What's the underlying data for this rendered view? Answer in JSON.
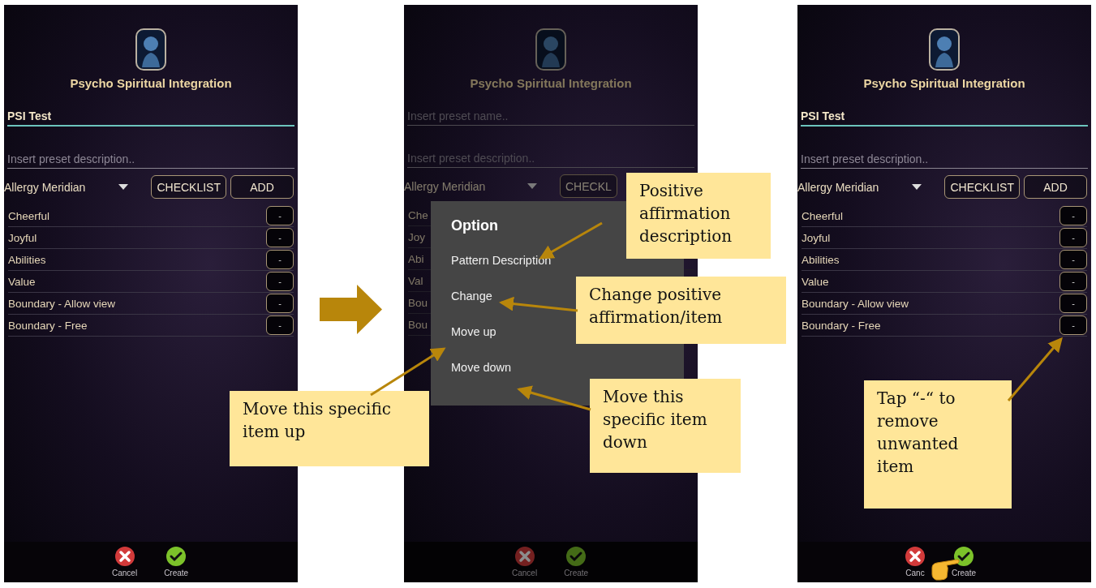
{
  "phones": [
    {
      "dimmed": false,
      "title": "Psycho Spiritual Integration",
      "name_field": {
        "value": "PSI Test",
        "focused": true
      },
      "description_field": {
        "placeholder": "Insert preset description.."
      },
      "dropdown": {
        "value": "Allergy Meridian"
      },
      "buttons": [
        "CHECKLIST",
        "ADD"
      ],
      "remove_buttons": true,
      "items": [
        {
          "label": "Cheerful",
          "remove": "-"
        },
        {
          "label": "Joyful",
          "remove": "-"
        },
        {
          "label": "Abilities",
          "remove": "-"
        },
        {
          "label": "Value",
          "remove": "-"
        },
        {
          "label": "Boundary - Allow view",
          "remove": "-"
        },
        {
          "label": "Boundary - Free",
          "remove": "-"
        }
      ],
      "footer": [
        {
          "kind": "cancel",
          "label": "Cancel"
        },
        {
          "kind": "create",
          "label": "Create"
        }
      ],
      "pointer_hand": false
    },
    {
      "dimmed": true,
      "title": "Psycho Spiritual Integration",
      "name_field": {
        "placeholder": "Insert preset name..",
        "focused": false
      },
      "description_field": {
        "placeholder": "Insert preset description.."
      },
      "dropdown": {
        "value": "Allergy Meridian"
      },
      "buttons": [
        "CHECKL"
      ],
      "remove_buttons": false,
      "items": [
        {
          "label": "Che"
        },
        {
          "label": "Joy"
        },
        {
          "label": "Abi"
        },
        {
          "label": "Val"
        },
        {
          "label": "Bou"
        },
        {
          "label": "Bou"
        }
      ],
      "footer": [
        {
          "kind": "cancel",
          "label": "Cancel"
        },
        {
          "kind": "create",
          "label": "Create"
        }
      ],
      "pointer_hand": false,
      "dialog": {
        "title": "Option",
        "options": [
          "Pattern Description",
          "Change",
          "Move up",
          "Move down"
        ]
      }
    },
    {
      "dimmed": false,
      "title": "Psycho Spiritual Integration",
      "name_field": {
        "value": "PSI Test",
        "focused": true
      },
      "description_field": {
        "placeholder": "Insert preset description.."
      },
      "dropdown": {
        "value": "Allergy Meridian"
      },
      "buttons": [
        "CHECKLIST",
        "ADD"
      ],
      "remove_buttons": true,
      "items": [
        {
          "label": "Cheerful",
          "remove": "-"
        },
        {
          "label": "Joyful",
          "remove": "-"
        },
        {
          "label": "Abilities",
          "remove": "-"
        },
        {
          "label": "Value",
          "remove": "-"
        },
        {
          "label": "Boundary - Allow view",
          "remove": "-"
        },
        {
          "label": "Boundary - Free",
          "remove": "-"
        }
      ],
      "footer": [
        {
          "kind": "cancel",
          "label": "Canc"
        },
        {
          "kind": "create",
          "label": "Create"
        }
      ],
      "pointer_hand": true
    }
  ],
  "callouts": [
    {
      "text": "Positive affirmation description"
    },
    {
      "text": "Change positive affirmation/item"
    },
    {
      "text": "Move this specific item up"
    },
    {
      "text": "Move this specific item down"
    },
    {
      "text": "Tap “-“ to remove unwanted item"
    }
  ]
}
